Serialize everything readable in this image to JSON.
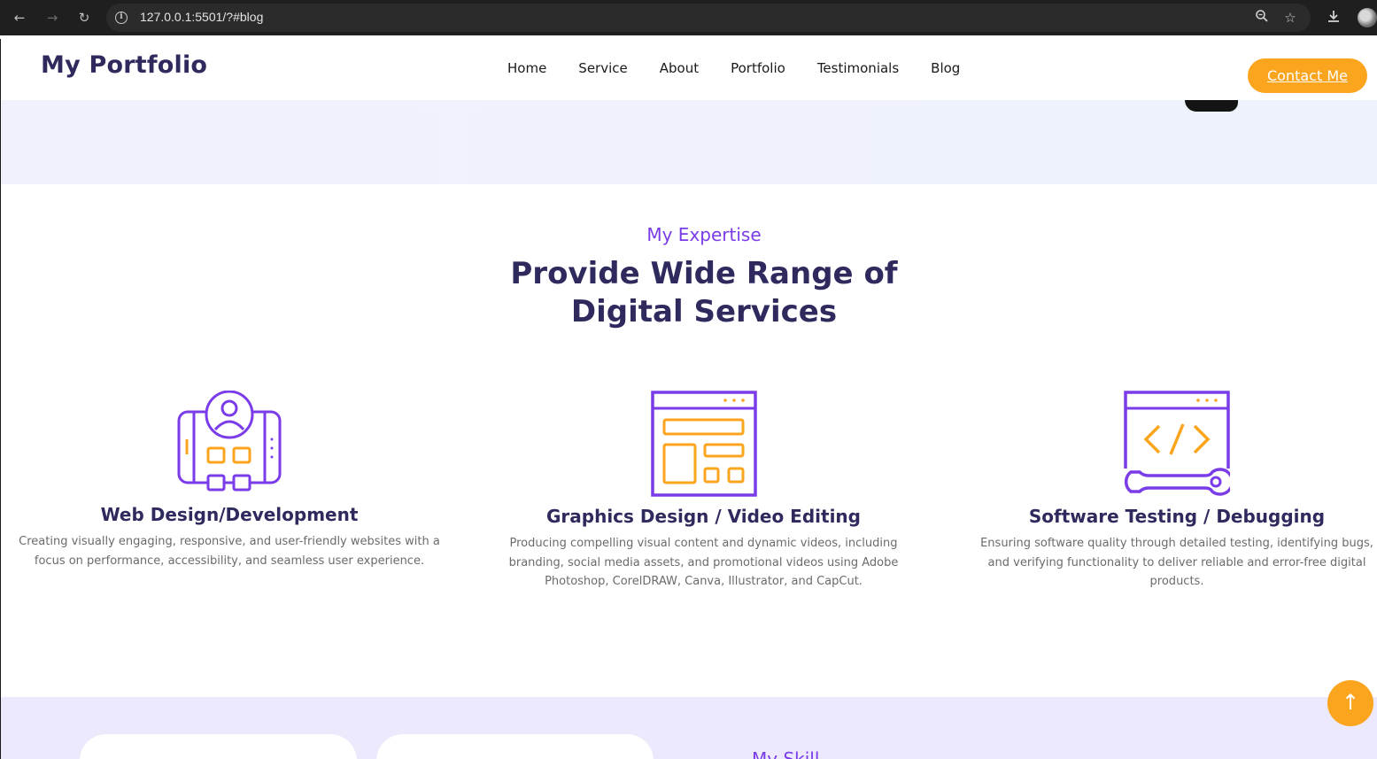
{
  "browser": {
    "url": "127.0.0.1:5501/?#blog",
    "back_icon": "arrow-left-icon",
    "forward_icon": "arrow-right-icon",
    "reload_icon": "reload-icon"
  },
  "header": {
    "logo": "My Portfolio",
    "nav": [
      "Home",
      "Service",
      "About",
      "Portfolio",
      "Testimonials",
      "Blog"
    ],
    "contact_label": "Contact Me"
  },
  "expertise": {
    "subtitle": "My Expertise",
    "title_line1": "Provide Wide Range of",
    "title_line2": "Digital Services",
    "services": [
      {
        "icon": "responsive-design-icon",
        "title": "Web Design/Development",
        "description": "Creating visually engaging, responsive, and user-friendly websites with a focus on performance, accessibility, and seamless user experience."
      },
      {
        "icon": "layout-design-icon",
        "title": "Graphics Design / Video Editing",
        "description": "Producing compelling visual content and dynamic videos, including branding, social media assets, and promotional videos using Adobe Photoshop, CorelDRAW, Canva, Illustrator, and CapCut."
      },
      {
        "icon": "code-wrench-icon",
        "title": "Software Testing / Debugging",
        "description": "Ensuring software quality through detailed testing, identifying bugs, and verifying functionality to deliver reliable and error-free digital products."
      }
    ]
  },
  "skills": {
    "label": "My Skill"
  },
  "colors": {
    "primary": "#2f2a5e",
    "accent_purple": "#7a3be8",
    "accent_orange": "#fba51f",
    "hero_bg": "#eef2fd",
    "skills_bg": "#ebe9fb"
  }
}
